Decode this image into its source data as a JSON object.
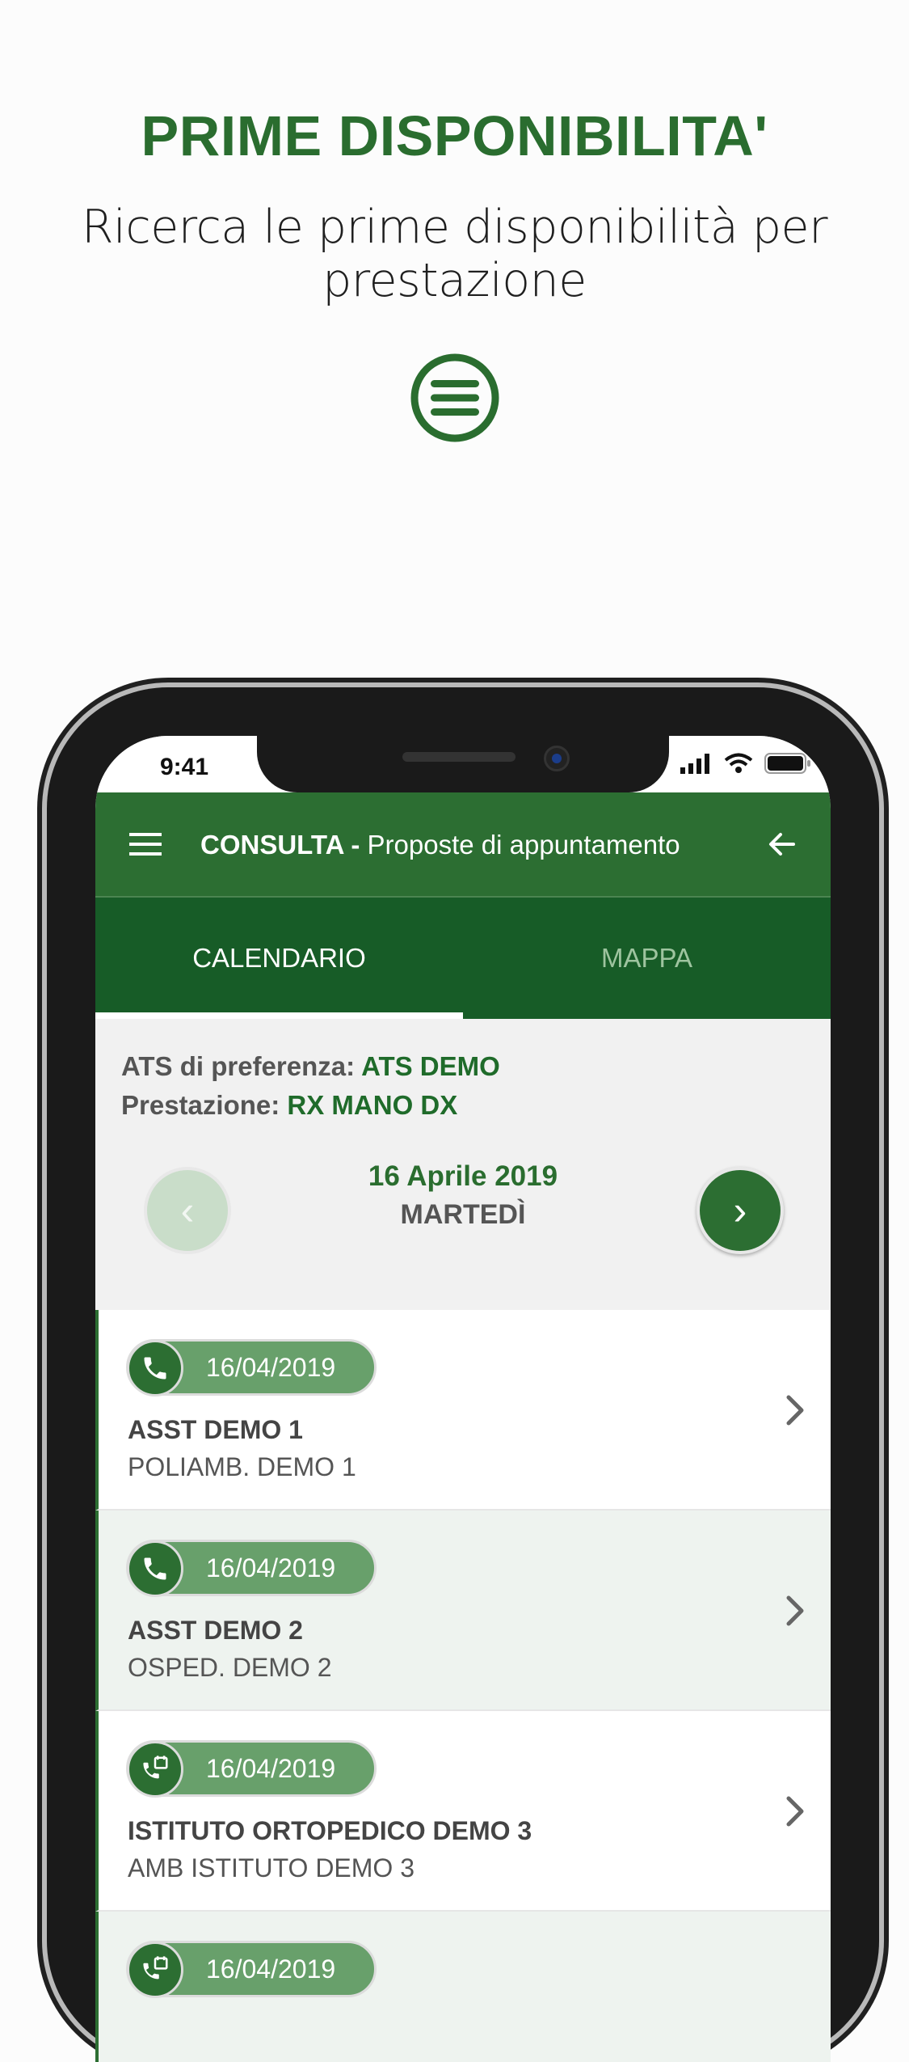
{
  "promo": {
    "title": "PRIME DISPONIBILITA'",
    "subtitle": "Ricerca le prime disponibilità per prestazione",
    "icon": "menu-circle-icon"
  },
  "status": {
    "time": "9:41"
  },
  "appbar": {
    "title_bold": "CONSULTA -",
    "title_rest": " Proposte di appuntamento"
  },
  "tabs": {
    "calendar": "CALENDARIO",
    "map": "MAPPA",
    "active": "CALENDARIO"
  },
  "info": {
    "ats_label": "ATS di preferenza:",
    "ats_value": "ATS DEMO",
    "service_label": "Prestazione:",
    "service_value": "RX MANO DX"
  },
  "date_nav": {
    "date": "16 Aprile 2019",
    "weekday": "MARTEDÌ",
    "prev": "‹",
    "next": "›"
  },
  "appointments": [
    {
      "date": "16/04/2019",
      "name": "ASST DEMO 1",
      "place": "POLIAMB. DEMO 1",
      "icon": "phone-icon"
    },
    {
      "date": "16/04/2019",
      "name": "ASST DEMO 2",
      "place": "OSPED. DEMO 2",
      "icon": "phone-icon"
    },
    {
      "date": "16/04/2019",
      "name": "ISTITUTO ORTOPEDICO DEMO 3",
      "place": "AMB ISTITUTO DEMO 3",
      "icon": "phone-calendar-icon"
    },
    {
      "date": "16/04/2019",
      "name": "",
      "place": "",
      "icon": "phone-calendar-icon"
    }
  ],
  "colors": {
    "primary": "#2c6e32",
    "tabs_bg": "#175c27",
    "pill": "#68a06b"
  }
}
